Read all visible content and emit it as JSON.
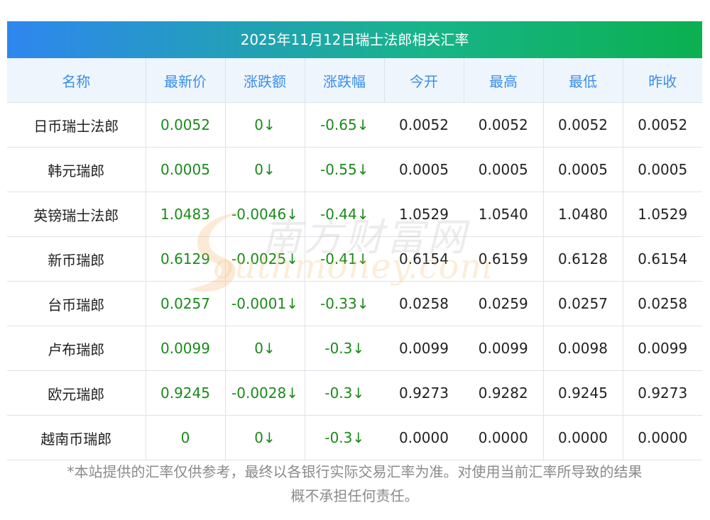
{
  "title": "2025年11月12日瑞士法郎相关汇率",
  "headers": [
    "名称",
    "最新价",
    "涨跌额",
    "涨跌幅",
    "今开",
    "最高",
    "最低",
    "昨收"
  ],
  "rows": [
    [
      "日币瑞士法郎",
      "0.0052",
      "0↓",
      "-0.65↓",
      "0.0052",
      "0.0052",
      "0.0052",
      "0.0052"
    ],
    [
      "韩元瑞郎",
      "0.0005",
      "0↓",
      "-0.55↓",
      "0.0005",
      "0.0005",
      "0.0005",
      "0.0005"
    ],
    [
      "英镑瑞士法郎",
      "1.0483",
      "-0.0046↓",
      "-0.44↓",
      "1.0529",
      "1.0540",
      "1.0480",
      "1.0529"
    ],
    [
      "新币瑞郎",
      "0.6129",
      "-0.0025↓",
      "-0.41↓",
      "0.6154",
      "0.6159",
      "0.6128",
      "0.6154"
    ],
    [
      "台币瑞郎",
      "0.0257",
      "-0.0001↓",
      "-0.33↓",
      "0.0258",
      "0.0259",
      "0.0257",
      "0.0258"
    ],
    [
      "卢布瑞郎",
      "0.0099",
      "0↓",
      "-0.3↓",
      "0.0099",
      "0.0099",
      "0.0098",
      "0.0099"
    ],
    [
      "欧元瑞郎",
      "0.9245",
      "-0.0028↓",
      "-0.3↓",
      "0.9273",
      "0.9282",
      "0.9245",
      "0.9273"
    ],
    [
      "越南币瑞郎",
      "0",
      "0↓",
      "-0.3↓",
      "0.0000",
      "0.0000",
      "0.0000",
      "0.0000"
    ]
  ],
  "footnote_line1": "*本站提供的汇率仅供参考，最终以各银行实际交易汇率为准。对使用当前汇率所导致的结果",
  "footnote_line2": "概不承担任何责任。",
  "watermark": {
    "cn": "南方财富网",
    "en": "outhmoney.com"
  },
  "colors": {
    "header_text": "#3b8ee8",
    "header_bg": "#eef5fc",
    "positive": "#1a8a1a",
    "title_gradient_start": "#2f86f0",
    "title_gradient_end": "#0bb04f"
  }
}
